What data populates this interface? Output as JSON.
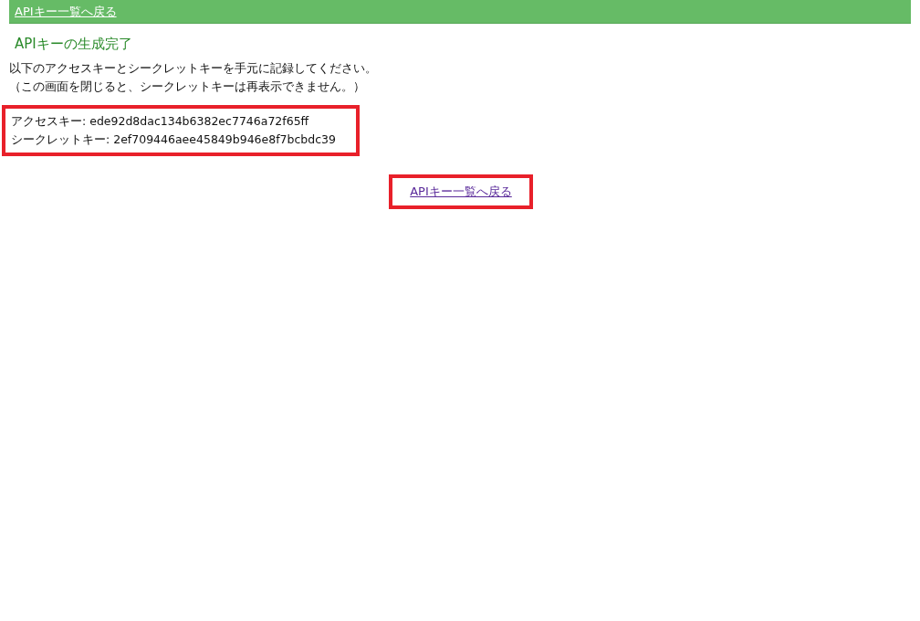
{
  "header_link": "APIキー一覧へ戻る",
  "title": "APIキーの生成完了",
  "message": [
    "以下のアクセスキーとシークレットキーを手元に記録してください。",
    "（この画面を閉じると、シークレットキーは再表示できません。）"
  ],
  "keys": [
    {
      "label": "アクセスキー:",
      "value": "ede92d8dac134b6382ec7746a72f65ff"
    },
    {
      "label": "シークレットキー:",
      "value": "2ef709446aee45849b946e8f7bcbdc39"
    }
  ],
  "back_link": "APIキー一覧へ戻る"
}
